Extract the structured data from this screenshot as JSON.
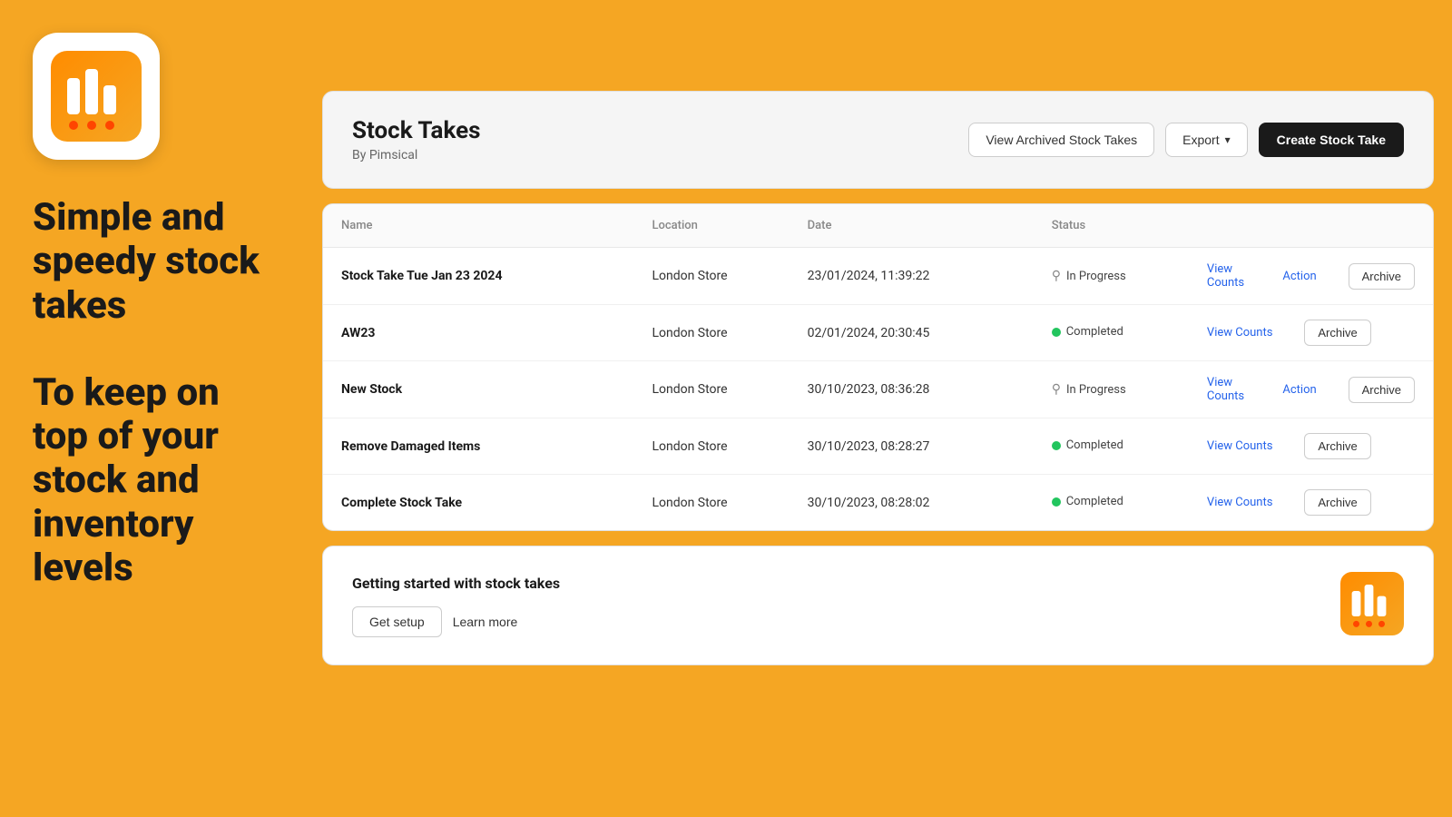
{
  "brand": {
    "name": "Pimsical"
  },
  "left": {
    "tagline1": "Simple and speedy stock takes",
    "tagline2": "To keep on top of your stock and inventory levels"
  },
  "header": {
    "title": "Stock Takes",
    "subtitle": "By Pimsical",
    "btn_view_archived": "View Archived Stock Takes",
    "btn_export": "Export",
    "btn_create": "Create Stock Take"
  },
  "table": {
    "columns": [
      "Name",
      "Location",
      "Date",
      "Status",
      ""
    ],
    "rows": [
      {
        "name": "Stock Take Tue Jan 23 2024",
        "location": "London Store",
        "date": "23/01/2024, 11:39:22",
        "status": "In Progress",
        "status_type": "in_progress",
        "has_action": true
      },
      {
        "name": "AW23",
        "location": "London Store",
        "date": "02/01/2024, 20:30:45",
        "status": "Completed",
        "status_type": "completed",
        "has_action": false
      },
      {
        "name": "New Stock",
        "location": "London Store",
        "date": "30/10/2023, 08:36:28",
        "status": "In Progress",
        "status_type": "in_progress",
        "has_action": true
      },
      {
        "name": "Remove Damaged Items",
        "location": "London Store",
        "date": "30/10/2023, 08:28:27",
        "status": "Completed",
        "status_type": "completed",
        "has_action": false
      },
      {
        "name": "Complete Stock Take",
        "location": "London Store",
        "date": "30/10/2023, 08:28:02",
        "status": "Completed",
        "status_type": "completed",
        "has_action": false
      }
    ],
    "btn_view_counts": "View Counts",
    "btn_action": "Action",
    "btn_archive": "Archive"
  },
  "getting_started": {
    "title": "Getting started with stock takes",
    "btn_setup": "Get setup",
    "btn_learn": "Learn more"
  },
  "colors": {
    "bg": "#F5A623",
    "primary_btn": "#1a1a1a",
    "completed_dot": "#22c55e",
    "link": "#2563eb"
  }
}
